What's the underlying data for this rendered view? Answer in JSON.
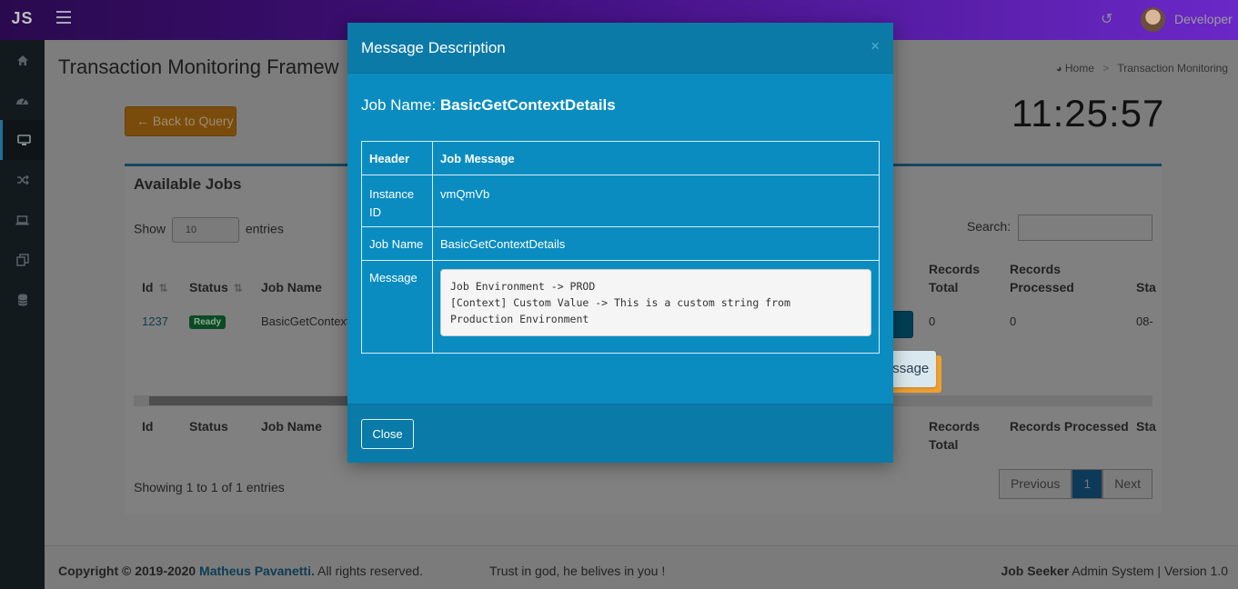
{
  "navbar": {
    "logo": "JS",
    "user_name": "Developer"
  },
  "sidebar": {
    "items": [
      "home-icon",
      "dashboard-icon",
      "monitor-icon",
      "shuffle-icon",
      "laptop-icon",
      "clone-icon",
      "database-icon"
    ],
    "active_index": 2
  },
  "page": {
    "title": "Transaction Monitoring Framew",
    "breadcrumb": {
      "home": "Home",
      "current": "Transaction Monitoring"
    },
    "back_button": "← Back to Query",
    "clock": "11:25:57"
  },
  "jobs_box": {
    "title": "Available Jobs",
    "show_label": "Show",
    "entries_label": "entries",
    "entries_value": "10",
    "search_label": "Search:",
    "headers": {
      "id": "Id",
      "status": "Status",
      "job_name": "Job Name",
      "records_total_1": "Records",
      "records_total_2": "Total",
      "records_processed_1": "Records",
      "records_processed_2": "Processed",
      "start": "Sta"
    },
    "footer_headers": {
      "id": "Id",
      "status": "Status",
      "job_name": "Job Name",
      "records_total_1": "Records",
      "records_total_2": "Total",
      "records_processed": "Records Processed",
      "start": "Sta"
    },
    "row": {
      "id": "1237",
      "status": "Ready",
      "job_name": "BasicGetContext",
      "records_total": "0",
      "records_processed": "0",
      "start": "08-"
    },
    "showing": "Showing 1 to 1 of 1 entries",
    "pagination": {
      "previous": "Previous",
      "page": "1",
      "next": "Next"
    }
  },
  "check_message_button": "Check Message",
  "modal": {
    "title": "Message Description",
    "close_symbol": "×",
    "job_name_label": "Job Name:",
    "job_name_value": "BasicGetContextDetails",
    "table": {
      "header_col": "Header",
      "message_col": "Job Message",
      "rows": [
        {
          "header": "Instance ID",
          "value": "vmQmVb"
        },
        {
          "header": "Job Name",
          "value": "BasicGetContextDetails"
        },
        {
          "header": "Message",
          "value": "Job Environment -> PROD\n[Context] Custom Value -> This is a custom string from\nProduction Environment"
        }
      ]
    },
    "close_button": "Close"
  },
  "footer": {
    "copyright_prefix": "Copyright © 2019-2020",
    "author": "Matheus Pavanetti.",
    "rights": "All rights reserved.",
    "motto": "Trust in god, he belives in you !",
    "brand": "Job Seeker",
    "system": "Admin System | Version 1.0"
  }
}
